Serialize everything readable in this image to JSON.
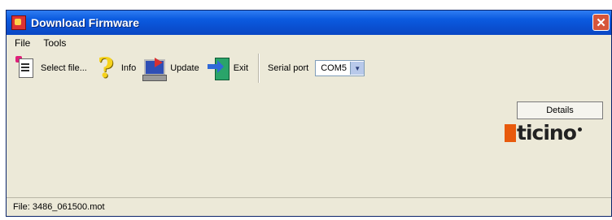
{
  "window": {
    "title": "Download Firmware",
    "close_glyph": "✕"
  },
  "menu": {
    "items": [
      "File",
      "Tools"
    ]
  },
  "toolbar": {
    "select_file_label": "Select file...",
    "info_label": "Info",
    "update_label": "Update",
    "exit_label": "Exit",
    "serial_port_label": "Serial port",
    "serial_port_value": "COM5"
  },
  "details": {
    "label": "Details"
  },
  "logo": {
    "text": "ticino"
  },
  "status": {
    "text": "File: 3486_061500.mot"
  },
  "colors": {
    "title_bar": "#0a4fd0",
    "logo_orange": "#e85a0c",
    "close_button": "#d6553a"
  },
  "icons": {
    "select_file": "open-file-icon",
    "info": "question-mark-icon",
    "update": "computer-update-icon",
    "exit": "exit-door-icon",
    "dropdown": "chevron-down-icon"
  }
}
